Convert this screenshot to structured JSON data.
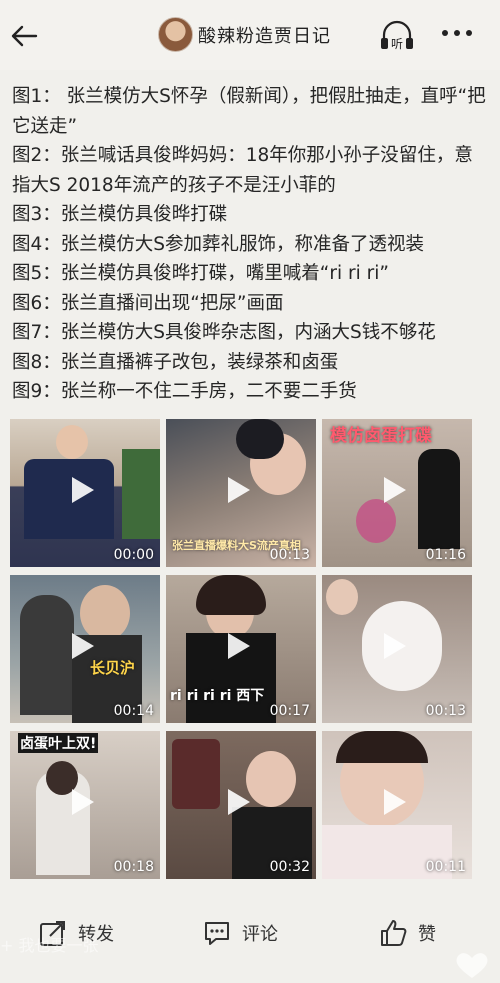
{
  "header": {
    "account_name": "酸辣粉造贾日记",
    "listen_label": "听"
  },
  "post": {
    "lines": [
      "图1：  张兰模仿大S怀孕（假新闻），把假肚抽走，直呼“把它送走”",
      "图2：张兰喊话具俊晔妈妈：18年你那小孙子没留住，意指大S 2018年流产的孩子不是汪小菲的",
      "图3：张兰模仿具俊晔打碟",
      "图4：张兰模仿大S参加葬礼服饰，称准备了透视装",
      "图5：张兰模仿具俊晔打碟，嘴里喊着“ri ri ri”",
      "图6：张兰直播间出现“把尿”画面",
      "图7：张兰模仿大S具俊晔杂志图，内涵大S钱不够花",
      "图8：张兰直播裤子改包，装绿茶和卤蛋",
      "图9：张兰称一不住二手房，二不要二手货"
    ]
  },
  "videos": [
    {
      "duration": "00:00",
      "caption": ""
    },
    {
      "duration": "00:13",
      "caption": "张兰直播爆料大S流产真相"
    },
    {
      "duration": "01:16",
      "caption": "模仿卤蛋打碟"
    },
    {
      "duration": "00:14",
      "caption": "长贝沪"
    },
    {
      "duration": "00:17",
      "caption": "ri ri ri ri 西下"
    },
    {
      "duration": "00:13",
      "caption": ""
    },
    {
      "duration": "00:18",
      "caption": "卤蛋叶上双!"
    },
    {
      "duration": "00:32",
      "caption": ""
    },
    {
      "duration": "00:11",
      "caption": ""
    }
  ],
  "actions": {
    "forward_label": "转发",
    "comment_label": "评论",
    "like_label": "赞"
  },
  "overlay_text": "+ 我也要一张"
}
